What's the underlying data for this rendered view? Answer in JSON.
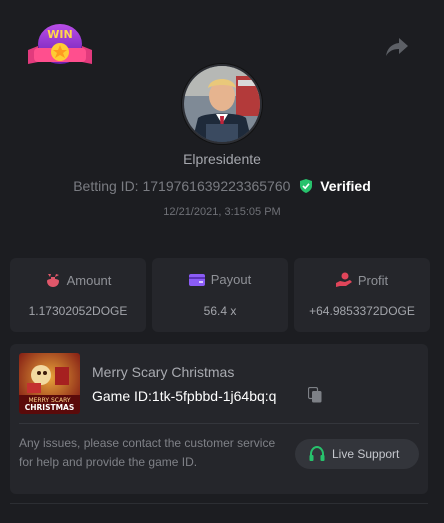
{
  "header": {
    "logo_icon": "win-badge-logo",
    "logo_text": "WIN",
    "share_icon": "share-arrow-icon"
  },
  "profile": {
    "avatar_icon": "user-avatar",
    "username": "Elpresidente",
    "betting_id_label": "Betting ID:",
    "betting_id": "1719761639223365760",
    "verified_label": "Verified",
    "timestamp": "12/21/2021, 3:15:05 PM"
  },
  "stats": [
    {
      "icon": "amount-icon",
      "label": "Amount",
      "value": "1.17302052DOGE",
      "icon_color": "#e0576a"
    },
    {
      "icon": "payout-icon",
      "label": "Payout",
      "value": "56.4 x",
      "icon_color": "#8b5cf6"
    },
    {
      "icon": "profit-icon",
      "label": "Profit",
      "value": "+64.9853372DOGE",
      "icon_color": "#e0455a"
    }
  ],
  "game": {
    "thumbnail_text_1": "MERRY SCARY",
    "thumbnail_text_2": "CHRISTMAS",
    "title": "Merry Scary Christmas",
    "id_label": "Game ID:",
    "id_value": "1tk-5fpbbd-1j64bq:q",
    "notice": "Any issues, please contact the customer service for help and provide the game ID.",
    "support_label": "Live Support"
  },
  "colors": {
    "background": "#1c1d21",
    "card": "#25262b",
    "verified_green": "#27c26c",
    "support_green": "#27c26c"
  }
}
